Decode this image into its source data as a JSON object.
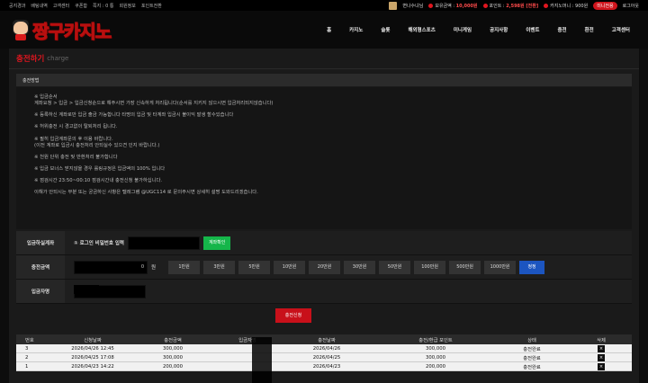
{
  "topbar": {
    "links": [
      "공지경과",
      "배팅내역",
      "고객센터",
      "쿠폰함",
      "쪽지 : 0 통",
      "회원정보",
      "포인트전환"
    ],
    "username": "변나수녀님",
    "balance_label": "보유금액 :",
    "balance_value": "10,000원",
    "point_label": "포인트 :",
    "point_value": "2,598원 [전환]",
    "casino_label": "카지노머니 :",
    "casino_value": "900원",
    "mini_button": "미니전용",
    "logout": "로그아웃"
  },
  "header": {
    "logo_text": "짱구카지노",
    "nav": [
      "홈",
      "카지노",
      "슬롯",
      "해외형스포츠",
      "미니게임",
      "공지사항",
      "이벤트",
      "충전",
      "환전",
      "고객센터"
    ]
  },
  "panel": {
    "title": "충전하기",
    "title_en": "charge",
    "section_head": "충전방법",
    "notice": [
      "※ 입금순서\n계좌요청 > 입금 > 입금신청순으로 해주시면 가장 신속하게 처리됩니다(순서를 지키지 않으시면 입금처리되지않습니다)",
      "※ 등록하신 계좌로만 입금 출금 가능합니다 타명의 입금 및 타계좌 입금시 불이익 발생 할수있습니다",
      "※ 허위충전 시 경고없이 탈퇴처리 됩니다.",
      "※ 필히 입금계좌문의 후 이용 바랍니다.\n(이전 계좌로 입금시 충전처리 안되실수 있으견 인지 바랍니다.)",
      "※ 천원 단위 충전 및 반환처리 불가합니다",
      "※ 입금 보너스 받지않을 경우 롤링규정은 입금액의 100% 입니다",
      "※ 점검시간 23:50~00:10 점검시간내 충전신청 불가하십니다.",
      "이해가 안되시는 부분 또는 궁금하신 사항은 텔레그램 @UGC114 로 문의주시면 상세히 설명 도와드리겠습니다."
    ],
    "form": {
      "account_label": "입금하실계좌",
      "account_prompt": "① 로그인 비밀번호 입력",
      "account_button": "계좌확인",
      "amount_label": "충전금액",
      "amount_value": "0",
      "amount_unit": "원",
      "amount_buttons": [
        "1만원",
        "3만원",
        "5만원",
        "10만원",
        "20만원",
        "30만원",
        "50만원",
        "100만원",
        "500만원",
        "1000만원"
      ],
      "reset_button": "정정",
      "depositor_label": "입금자명"
    },
    "submit_button": "충전신청"
  },
  "history": {
    "headers": [
      "번호",
      "신청날짜",
      "충전금액",
      "입금자명",
      "충전날짜",
      "충전/환급 포인트",
      "상태",
      "삭제"
    ],
    "rows": [
      {
        "no": "3",
        "req_date": "2026/04/26 12:45",
        "amount": "300,000",
        "name": "",
        "charge_date": "2026/04/26",
        "point": "300,000",
        "status": "충전완료",
        "del": "×"
      },
      {
        "no": "2",
        "req_date": "2026/04/25 17:08",
        "amount": "300,000",
        "name": "",
        "charge_date": "2026/04/25",
        "point": "300,000",
        "status": "충전완료",
        "del": "×"
      },
      {
        "no": "1",
        "req_date": "2026/04/23 14:22",
        "amount": "200,000",
        "name": "",
        "charge_date": "2026/04/23",
        "point": "200,000",
        "status": "충전완료",
        "del": "×"
      }
    ]
  }
}
